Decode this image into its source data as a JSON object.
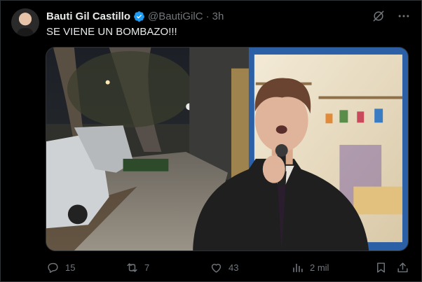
{
  "tweet": {
    "author_name": "Bauti Gil Castillo",
    "handle": "@BautiGilC",
    "separator": "·",
    "time": "3h",
    "text": "SE VIENE UN BOMBAZO!!!"
  },
  "icons": {
    "verified": "verified-badge-icon",
    "grok": "grok-icon",
    "more": "more-icon",
    "reply": "reply-icon",
    "retweet": "retweet-icon",
    "like": "heart-icon",
    "views": "views-icon",
    "bookmark": "bookmark-icon",
    "share": "share-icon"
  },
  "actions": {
    "replies": "15",
    "retweets": "7",
    "likes": "43",
    "views": "2 mil"
  },
  "colors": {
    "background": "#000000",
    "text_primary": "#e7e9ea",
    "text_secondary": "#71767b",
    "verified_blue": "#1d9bf0"
  }
}
